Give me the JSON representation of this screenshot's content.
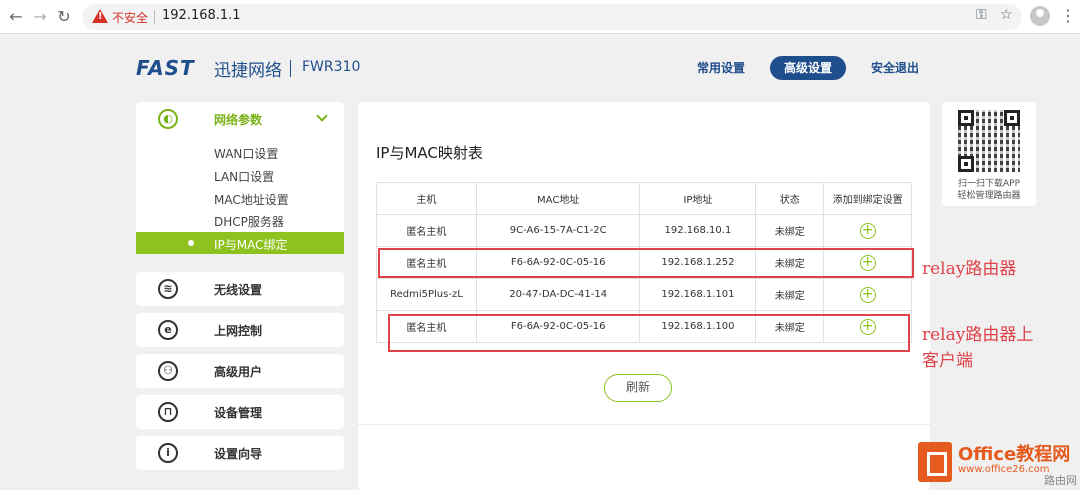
{
  "browser": {
    "insecure_label": "不安全",
    "url": "192.168.1.1"
  },
  "header": {
    "brand": "FAST",
    "brand_cn": "迅捷网络",
    "model": "FWR310",
    "nav": [
      "常用设置",
      "高级设置",
      "安全退出"
    ]
  },
  "sidebar": {
    "network_params": "网络参数",
    "sub_items": [
      "WAN口设置",
      "LAN口设置",
      "MAC地址设置",
      "DHCP服务器",
      "IP与MAC绑定"
    ],
    "sections": [
      "无线设置",
      "上网控制",
      "高级用户",
      "设备管理",
      "设置向导"
    ]
  },
  "main": {
    "title": "IP与MAC映射表",
    "columns": [
      "主机",
      "MAC地址",
      "IP地址",
      "状态",
      "添加到绑定设置"
    ],
    "rows": [
      {
        "host": "匿名主机",
        "mac": "9C-A6-15-7A-C1-2C",
        "ip": "192.168.10.1",
        "status": "未绑定"
      },
      {
        "host": "匿名主机",
        "mac": "F6-6A-92-0C-05-16",
        "ip": "192.168.1.252",
        "status": "未绑定"
      },
      {
        "host": "Redmi5Plus-zL",
        "mac": "20-47-DA-DC-41-14",
        "ip": "192.168.1.101",
        "status": "未绑定"
      },
      {
        "host": "匿名主机",
        "mac": "F6-6A-92-0C-05-16",
        "ip": "192.168.1.100",
        "status": "未绑定"
      }
    ],
    "refresh_label": "刷新"
  },
  "qr": {
    "line1": "扫一扫下载APP",
    "line2": "轻松管理路由器"
  },
  "annotations": {
    "relay_router": "relay路由器",
    "relay_client_line1": "relay路由器上",
    "relay_client_line2": "客户端"
  },
  "watermark": {
    "title": "Office教程网",
    "url": "www.office26.com",
    "small": "路由网"
  },
  "colors": {
    "brand_blue": "#1f4e8c",
    "accent_green": "#8dc21f",
    "annotation_red": "#e0424a",
    "watermark_orange": "#e65a1e"
  }
}
